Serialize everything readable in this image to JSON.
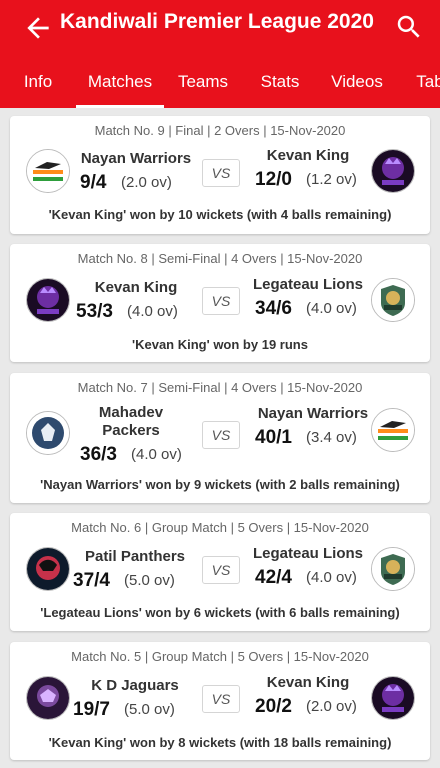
{
  "header": {
    "title": "Kandiwali Premier League 2020",
    "back_icon": "arrow-left-icon",
    "search_icon": "search-icon",
    "color": "#e8111c"
  },
  "tabs": [
    {
      "label": "Info",
      "active": false
    },
    {
      "label": "Matches",
      "active": true
    },
    {
      "label": "Teams",
      "active": false
    },
    {
      "label": "Stats",
      "active": false
    },
    {
      "label": "Videos",
      "active": false
    },
    {
      "label": "Tab",
      "active": false
    }
  ],
  "matches": [
    {
      "meta": "Match No. 9 | Final | 2 Overs | 15-Nov-2020",
      "team1": {
        "name": "Nayan Warriors",
        "score": "9/4",
        "overs": "(2.0 ov)",
        "logo": "nayan-warriors-logo"
      },
      "team2": {
        "name": "Kevan King",
        "score": "12/0",
        "overs": "(1.2 ov)",
        "logo": "kevan-king-logo"
      },
      "vs": "VS",
      "result": "'Kevan King'  won by 10 wickets (with 4 balls remaining)"
    },
    {
      "meta": "Match No. 8 | Semi-Final | 4 Overs | 15-Nov-2020",
      "team1": {
        "name": "Kevan King",
        "score": "53/3",
        "overs": "(4.0 ov)",
        "logo": "kevan-king-logo"
      },
      "team2": {
        "name": "Legateau Lions",
        "score": "34/6",
        "overs": "(4.0 ov)",
        "logo": "legateau-lions-logo"
      },
      "vs": "VS",
      "result": "'Kevan King'  won by 19 runs"
    },
    {
      "meta": "Match No. 7 | Semi-Final | 4 Overs | 15-Nov-2020",
      "team1": {
        "name_line1": "Mahadev",
        "name_line2": "Packers",
        "score": "36/3",
        "overs": "(4.0 ov)",
        "logo": "mahadev-packers-logo"
      },
      "team2": {
        "name": "Nayan Warriors",
        "score": "40/1",
        "overs": "(3.4 ov)",
        "logo": "nayan-warriors-logo"
      },
      "vs": "VS",
      "result": "'Nayan Warriors'  won by 9 wickets (with 2 balls remaining)"
    },
    {
      "meta": "Match No. 6 | Group Match | 5 Overs | 15-Nov-2020",
      "team1": {
        "name": "Patil Panthers",
        "score": "37/4",
        "overs": "(5.0 ov)",
        "logo": "patil-panthers-logo"
      },
      "team2": {
        "name": "Legateau Lions",
        "score": "42/4",
        "overs": "(4.0 ov)",
        "logo": "legateau-lions-logo"
      },
      "vs": "VS",
      "result": "'Legateau Lions'  won by 6 wickets (with 6 balls remaining)"
    },
    {
      "meta": "Match No. 5 | Group Match | 5 Overs | 15-Nov-2020",
      "team1": {
        "name": "K D Jaguars",
        "score": "19/7",
        "overs": "(5.0 ov)",
        "logo": "kd-jaguars-logo"
      },
      "team2": {
        "name": "Kevan King",
        "score": "20/2",
        "overs": "(2.0 ov)",
        "logo": "kevan-king-logo"
      },
      "vs": "VS",
      "result": "'Kevan King'  won by 8 wickets (with 18 balls remaining)"
    }
  ]
}
